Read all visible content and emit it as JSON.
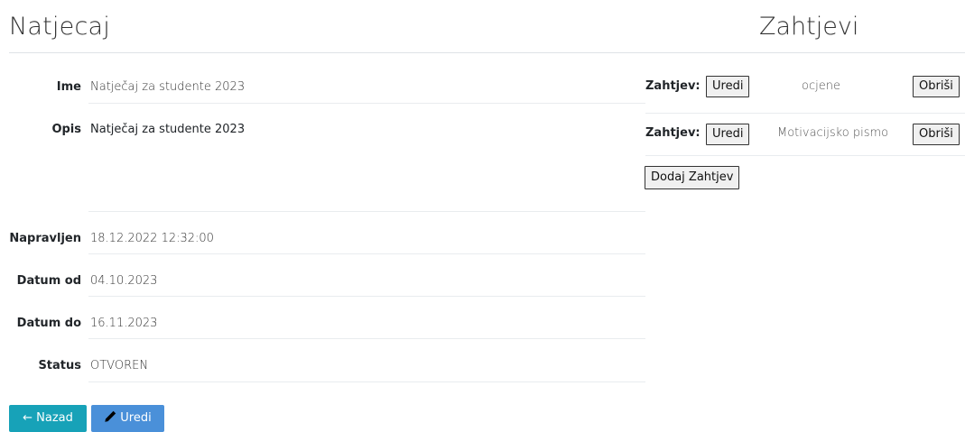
{
  "header": {
    "left_title": "Natjecaj",
    "right_title": "Zahtjevi"
  },
  "details": {
    "name_label": "Ime",
    "name_value": "Natječaj za studente 2023",
    "desc_label": "Opis",
    "desc_value": "Natječaj za studente 2023",
    "created_label": "Napravljen",
    "created_value": "18.12.2022 12:32:00",
    "date_from_label": "Datum od",
    "date_from_value": "04.10.2023",
    "date_to_label": "Datum do",
    "date_to_value": "16.11.2023",
    "status_label": "Status",
    "status_value": "OTVOREN"
  },
  "requirements": {
    "items": [
      {
        "label": "Zahtjev:",
        "edit": "Uredi",
        "name": "ocjene",
        "delete": "Obriši"
      },
      {
        "label": "Zahtjev:",
        "edit": "Uredi",
        "name": "Motivacijsko pismo",
        "delete": "Obriši"
      }
    ],
    "add_label": "Dodaj Zahtjev"
  },
  "actions": {
    "back_arrow": "←",
    "back_label": "Nazad",
    "edit_label": "Uredi"
  },
  "colors": {
    "back_button": "#17a2b8",
    "edit_button": "#4a90d9"
  },
  "icons": {
    "back": "arrow-left-icon",
    "edit": "pencil-icon"
  }
}
